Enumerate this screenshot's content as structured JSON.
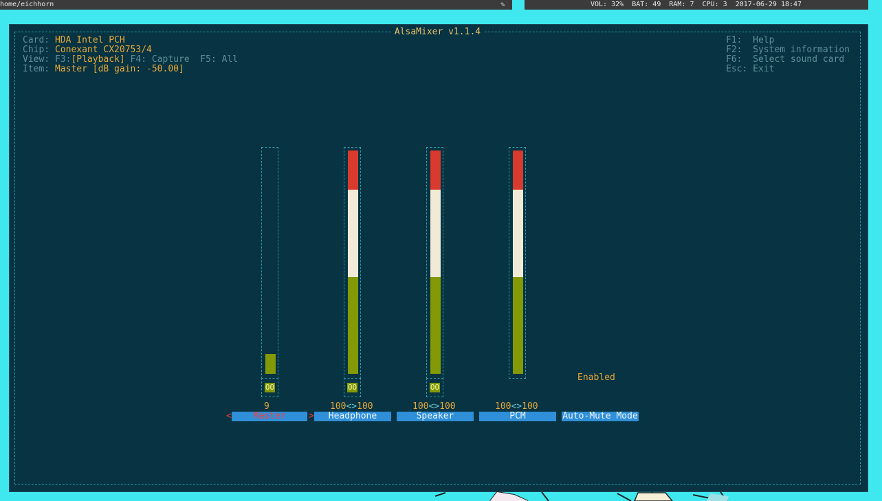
{
  "topbar": {
    "path": "home/eichhorn",
    "status": "VOL: 32%  BAT: 49  RAM: 7  CPU: 3  2017-06-29 18:47"
  },
  "title": "AlsaMixer v1.1.4",
  "info": {
    "card_label": "Card: ",
    "card": "HDA Intel PCH",
    "chip_label": "Chip: ",
    "chip": "Conexant CX20753/4",
    "view_label": "View: ",
    "view_f3": "F3:",
    "view_f3_value": "[Playback]",
    "view_f4": " F4: Capture  F5: All",
    "item_label": "Item: ",
    "item": "Master [dB gain: -50.00]"
  },
  "help": [
    "F1:  Help",
    "F2:  System information",
    "F6:  Select sound card",
    "Esc: Exit"
  ],
  "channels": [
    {
      "name": "Master",
      "level": 0.09,
      "value": "9",
      "mute": "OO",
      "selected": true
    },
    {
      "name": "Headphone",
      "level": 1.0,
      "value_left": "100",
      "value_sep": "<>",
      "value_right": "100",
      "mute": "OO"
    },
    {
      "name": "Speaker",
      "level": 1.0,
      "value_left": "100",
      "value_sep": "<>",
      "value_right": "100",
      "mute": "OO"
    },
    {
      "name": "PCM",
      "level": 1.0,
      "value_left": "100",
      "value_sep": "<>",
      "value_right": "100"
    },
    {
      "name": "Auto-Mute Mode",
      "state": "Enabled"
    }
  ],
  "selector": {
    "left": "<",
    "right": ">"
  },
  "colors": {
    "background": "#073342",
    "accent": "#e8a93a",
    "label_bg": "#2f8fd8",
    "bar_green": "#839a06",
    "bar_white": "#f0ead6",
    "bar_red": "#d93a2e"
  }
}
